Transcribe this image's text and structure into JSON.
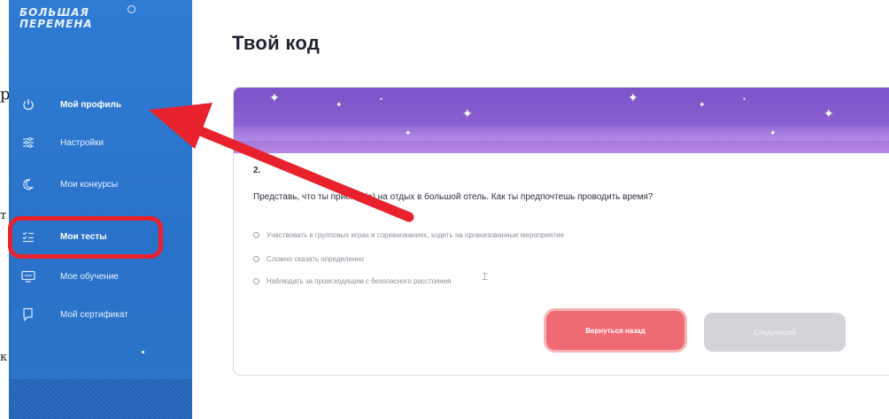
{
  "sidebar": {
    "logo_line1": "БОЛЬШАЯ",
    "logo_line2": "ПЕРЕМЕНА",
    "items": [
      {
        "label": "Мой профиль",
        "icon": "power-icon",
        "active": true
      },
      {
        "label": "Настройки",
        "icon": "sliders-icon"
      },
      {
        "label": "Мои конкурсы",
        "icon": "crescent-icon"
      },
      {
        "label": "Мои тесты",
        "icon": "checklist-icon"
      },
      {
        "label": "Мое обучение",
        "icon": "monitor-icon"
      },
      {
        "label": "Мой сертификат",
        "icon": "certificate-icon"
      }
    ]
  },
  "main": {
    "title": "Твой код",
    "question_number": "2.",
    "question": "Представь, что ты приехал(а) на отдых в большой отель. Как ты предпочтешь проводить время?",
    "options": [
      "Участвовать в групповых играх и соревнованиях, ходить на организованные мероприятия",
      "Сложно сказать определенно",
      "Наблюдать за происходящим с безопасного расстояния"
    ],
    "back_button": "Вернуться назад",
    "next_button": "Следующий"
  },
  "page_edge_chars": [
    "р",
    "т",
    "к"
  ],
  "colors": {
    "sidebar": "#2f7bd3",
    "banner": "#8a5fd1",
    "annotation": "#e8222c",
    "back_button": "#f06a73",
    "next_button": "#d2d4d8"
  }
}
